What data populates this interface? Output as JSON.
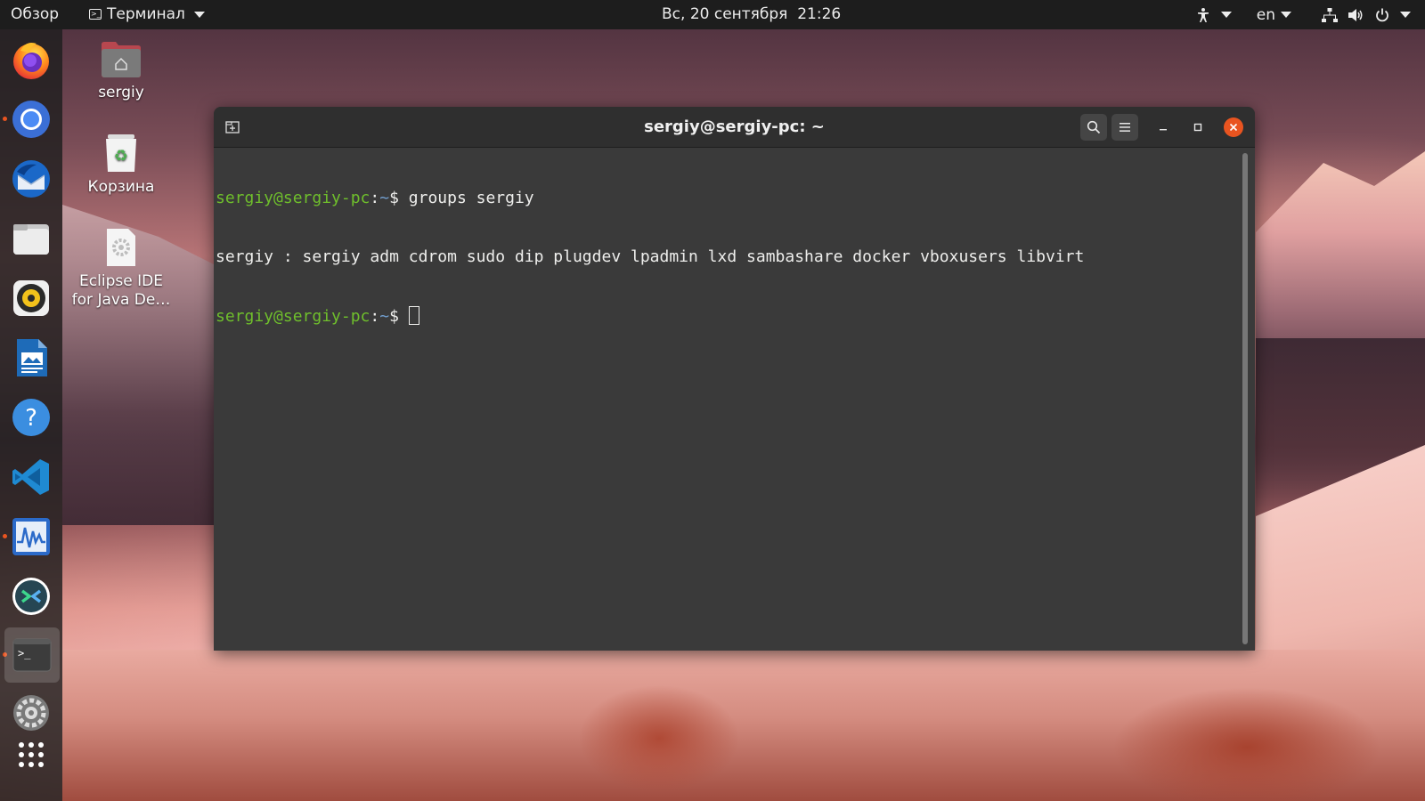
{
  "topbar": {
    "activities": "Обзор",
    "app_menu_label": "Терминал",
    "clock": "Вс, 20 сентября  21:26",
    "language": "en"
  },
  "dock": {
    "items": [
      {
        "name": "firefox-icon"
      },
      {
        "name": "chromium-icon"
      },
      {
        "name": "thunderbird-icon"
      },
      {
        "name": "files-icon"
      },
      {
        "name": "rhythmbox-icon"
      },
      {
        "name": "libreoffice-writer-icon"
      },
      {
        "name": "help-icon"
      },
      {
        "name": "vscode-icon"
      },
      {
        "name": "system-monitor-icon"
      },
      {
        "name": "remmina-icon"
      },
      {
        "name": "terminal-icon"
      },
      {
        "name": "settings-icon"
      },
      {
        "name": "show-applications-icon"
      }
    ]
  },
  "desktop": {
    "icons": [
      {
        "label": "sergiy"
      },
      {
        "label": "Корзина"
      },
      {
        "label": "Eclipse IDE for Java De…"
      }
    ]
  },
  "terminal": {
    "title": "sergiy@sergiy-pc: ~",
    "lines": [
      {
        "user": "sergiy@sergiy-pc",
        "sep": ":",
        "path": "~",
        "sym": "$ ",
        "cmd": "groups sergiy"
      },
      {
        "output": "sergiy : sergiy adm cdrom sudo dip plugdev lpadmin lxd sambashare docker vboxusers libvirt"
      },
      {
        "user": "sergiy@sergiy-pc",
        "sep": ":",
        "path": "~",
        "sym": "$ ",
        "cmd": ""
      }
    ]
  },
  "colors": {
    "accent": "#e95420",
    "prompt_user": "#6fbf2c",
    "prompt_path": "#729fcf",
    "terminal_bg": "#3a3a3a"
  }
}
